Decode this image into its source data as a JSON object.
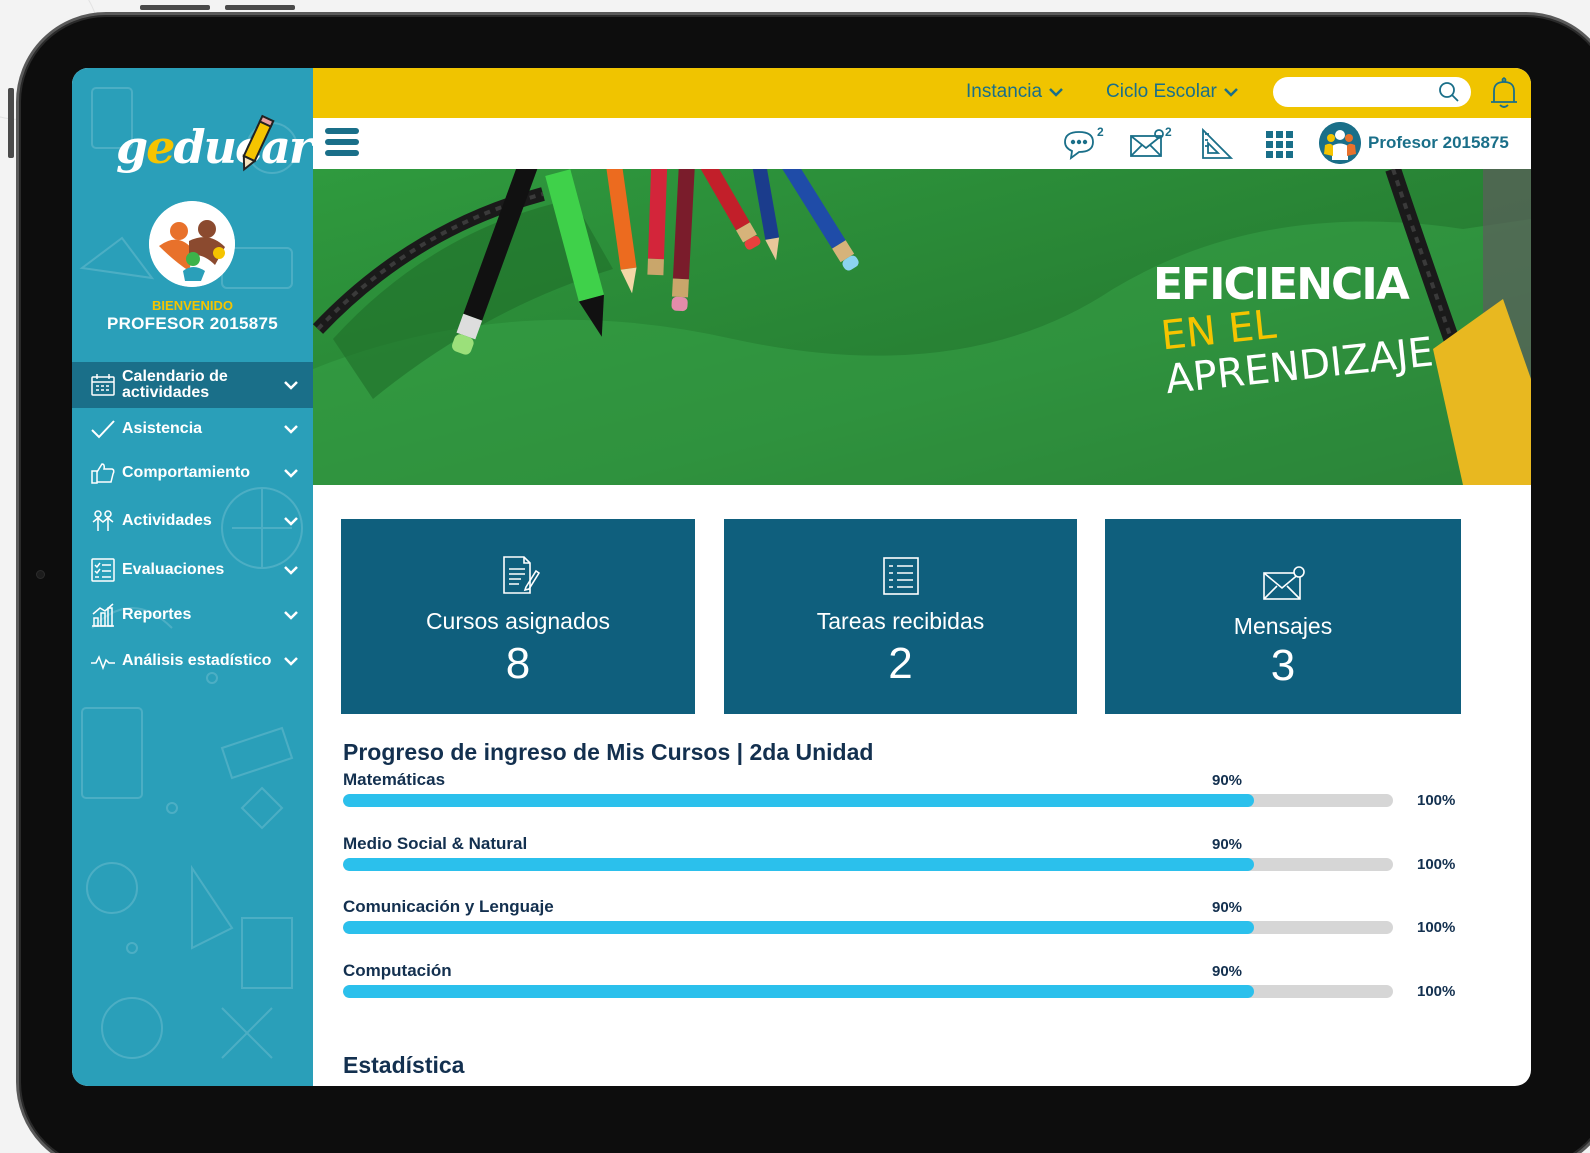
{
  "app": {
    "logo_text_pre": "g",
    "logo_text_e": "e",
    "logo_text_post": "ducar"
  },
  "sidebar": {
    "welcome": "BIENVENIDO",
    "profile_name": "PROFESOR 2015875",
    "items": [
      {
        "label": "Calendario de actividades",
        "icon": "calendar-icon",
        "active": true
      },
      {
        "label": "Asistencia",
        "icon": "checkmark-icon"
      },
      {
        "label": "Comportamiento",
        "icon": "thumbs-up-icon"
      },
      {
        "label": "Actividades",
        "icon": "activities-icon"
      },
      {
        "label": "Evaluaciones",
        "icon": "checklist-icon"
      },
      {
        "label": "Reportes",
        "icon": "bar-chart-icon"
      },
      {
        "label": "Análisis estadístico",
        "icon": "pulse-icon"
      }
    ]
  },
  "topbar": {
    "instancia_label": "Instancia",
    "ciclo_label": "Ciclo Escolar",
    "search_placeholder": ""
  },
  "header": {
    "chat_badge": "2",
    "mail_badge": "2",
    "user_name": "Profesor 2015875"
  },
  "banner": {
    "line1": "EFICIENCIA",
    "line2": "EN EL",
    "line3": "APRENDIZAJE"
  },
  "cards": [
    {
      "label": "Cursos asignados",
      "value": "8",
      "icon": "document-edit-icon"
    },
    {
      "label": "Tareas recibidas",
      "value": "2",
      "icon": "task-list-icon"
    },
    {
      "label": "Mensajes",
      "value": "3",
      "icon": "envelope-icon"
    }
  ],
  "progress": {
    "title": "Progreso de ingreso de Mis Cursos | 2da Unidad",
    "max_label": "100%",
    "courses": [
      {
        "name": "Matemáticas",
        "percent_label": "90%",
        "percent": 90
      },
      {
        "name": "Medio Social & Natural",
        "percent_label": "90%",
        "percent": 90
      },
      {
        "name": "Comunicación y Lenguaje",
        "percent_label": "90%",
        "percent": 90
      },
      {
        "name": "Computación",
        "percent_label": "90%",
        "percent": 90
      }
    ]
  },
  "stats": {
    "title": "Estadística"
  },
  "colors": {
    "sidebar": "#2a9fb9",
    "sidebar_active": "#1a6f89",
    "topbar": "#f0c400",
    "card": "#0f5f7d",
    "progress_fill": "#2bc0ec",
    "heading": "#13304f"
  }
}
